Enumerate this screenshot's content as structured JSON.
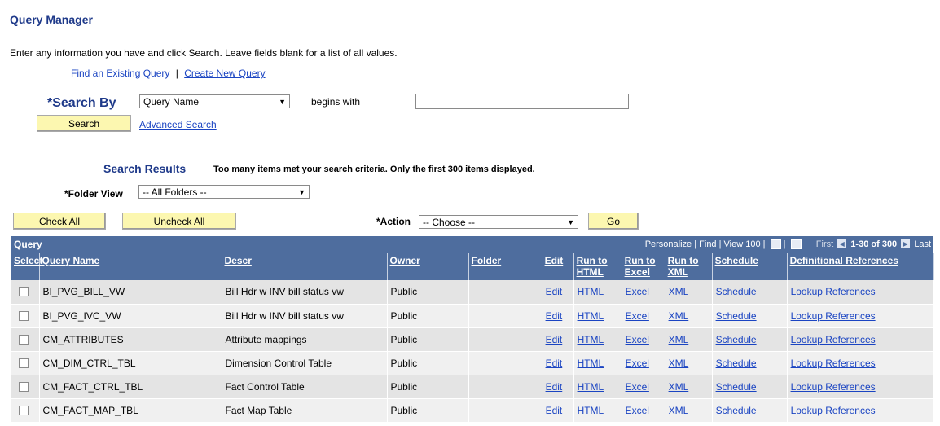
{
  "page_title": "Query Manager",
  "instructions": "Enter any information you have and click Search. Leave fields blank for a list of all values.",
  "find_links": {
    "find_existing": "Find an Existing Query",
    "separator": "|",
    "create_new": "Create New Query"
  },
  "search": {
    "search_by_label": "*Search By",
    "search_by_value": "Query Name",
    "operator": "begins with",
    "input_value": "",
    "search_button": "Search",
    "advanced_search": "Advanced Search"
  },
  "results": {
    "title": "Search Results",
    "message": "Too many items met your search criteria. Only the first 300 items displayed.",
    "folder_view_label": "*Folder View",
    "folder_view_value": "-- All Folders --",
    "check_all": "Check All",
    "uncheck_all": "Uncheck All",
    "action_label": "*Action",
    "action_value": "-- Choose --",
    "go_button": "Go"
  },
  "grid": {
    "label": "Query",
    "personalize": "Personalize",
    "find": "Find",
    "view100": "View 100",
    "first": "First",
    "range": "1-30 of 300",
    "last": "Last",
    "columns": {
      "select": "Select",
      "query_name": "Query Name",
      "descr": "Descr",
      "owner": "Owner",
      "folder": "Folder",
      "edit": "Edit",
      "run_html": "Run to HTML",
      "run_excel": "Run to Excel",
      "run_xml": "Run to XML",
      "schedule": "Schedule",
      "def_refs": "Definitional References"
    },
    "rows": [
      {
        "name": "BI_PVG_BILL_VW",
        "descr": "Bill Hdr w INV bill status vw",
        "owner": "Public",
        "folder": "",
        "edit": "Edit",
        "html": "HTML",
        "excel": "Excel",
        "xml": "XML",
        "schedule": "Schedule",
        "refs": "Lookup References"
      },
      {
        "name": "BI_PVG_IVC_VW",
        "descr": "Bill Hdr w INV bill status vw",
        "owner": "Public",
        "folder": "",
        "edit": "Edit",
        "html": "HTML",
        "excel": "Excel",
        "xml": "XML",
        "schedule": "Schedule",
        "refs": "Lookup References"
      },
      {
        "name": "CM_ATTRIBUTES",
        "descr": "Attribute mappings",
        "owner": "Public",
        "folder": "",
        "edit": "Edit",
        "html": "HTML",
        "excel": "Excel",
        "xml": "XML",
        "schedule": "Schedule",
        "refs": "Lookup References"
      },
      {
        "name": "CM_DIM_CTRL_TBL",
        "descr": "Dimension Control Table",
        "owner": "Public",
        "folder": "",
        "edit": "Edit",
        "html": "HTML",
        "excel": "Excel",
        "xml": "XML",
        "schedule": "Schedule",
        "refs": "Lookup References"
      },
      {
        "name": "CM_FACT_CTRL_TBL",
        "descr": "Fact Control Table",
        "owner": "Public",
        "folder": "",
        "edit": "Edit",
        "html": "HTML",
        "excel": "Excel",
        "xml": "XML",
        "schedule": "Schedule",
        "refs": "Lookup References"
      },
      {
        "name": "CM_FACT_MAP_TBL",
        "descr": "Fact Map Table",
        "owner": "Public",
        "folder": "",
        "edit": "Edit",
        "html": "HTML",
        "excel": "Excel",
        "xml": "XML",
        "schedule": "Schedule",
        "refs": "Lookup References"
      }
    ]
  }
}
